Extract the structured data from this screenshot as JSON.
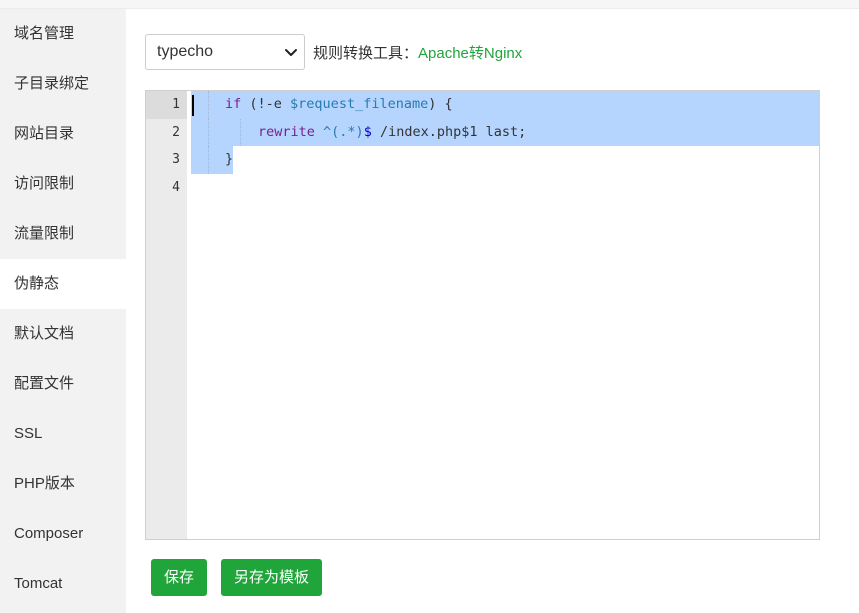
{
  "sidebar": {
    "items": [
      {
        "label": "域名管理"
      },
      {
        "label": "子目录绑定"
      },
      {
        "label": "网站目录"
      },
      {
        "label": "访问限制"
      },
      {
        "label": "流量限制"
      },
      {
        "label": "伪静态",
        "active": true
      },
      {
        "label": "默认文档"
      },
      {
        "label": "配置文件"
      },
      {
        "label": "SSL"
      },
      {
        "label": "PHP版本"
      },
      {
        "label": "Composer"
      },
      {
        "label": "Tomcat"
      }
    ]
  },
  "toolbar": {
    "template_select": {
      "selected": "typecho"
    },
    "tool_label": "规则转换工具：",
    "tool_link": "Apache转Nginx"
  },
  "editor": {
    "line_numbers": [
      "1",
      "2",
      "3",
      "4"
    ],
    "lines": {
      "l1": {
        "kw": "if",
        "a": " (!-e ",
        "var": "$request_filename",
        "b": ") {"
      },
      "l2": {
        "kw": "rewrite",
        "a": " ^(.*)",
        "dollar": "$",
        "b": " /index.php$1 last;"
      },
      "l3": {
        "a": "}"
      }
    }
  },
  "buttons": {
    "save": "保存",
    "save_as_template": "另存为模板"
  },
  "colors": {
    "accent": "#20a53a",
    "selection": "#b5d5ff",
    "sidebar_bg": "#f2f2f2",
    "gutter_bg": "#ebebeb"
  }
}
